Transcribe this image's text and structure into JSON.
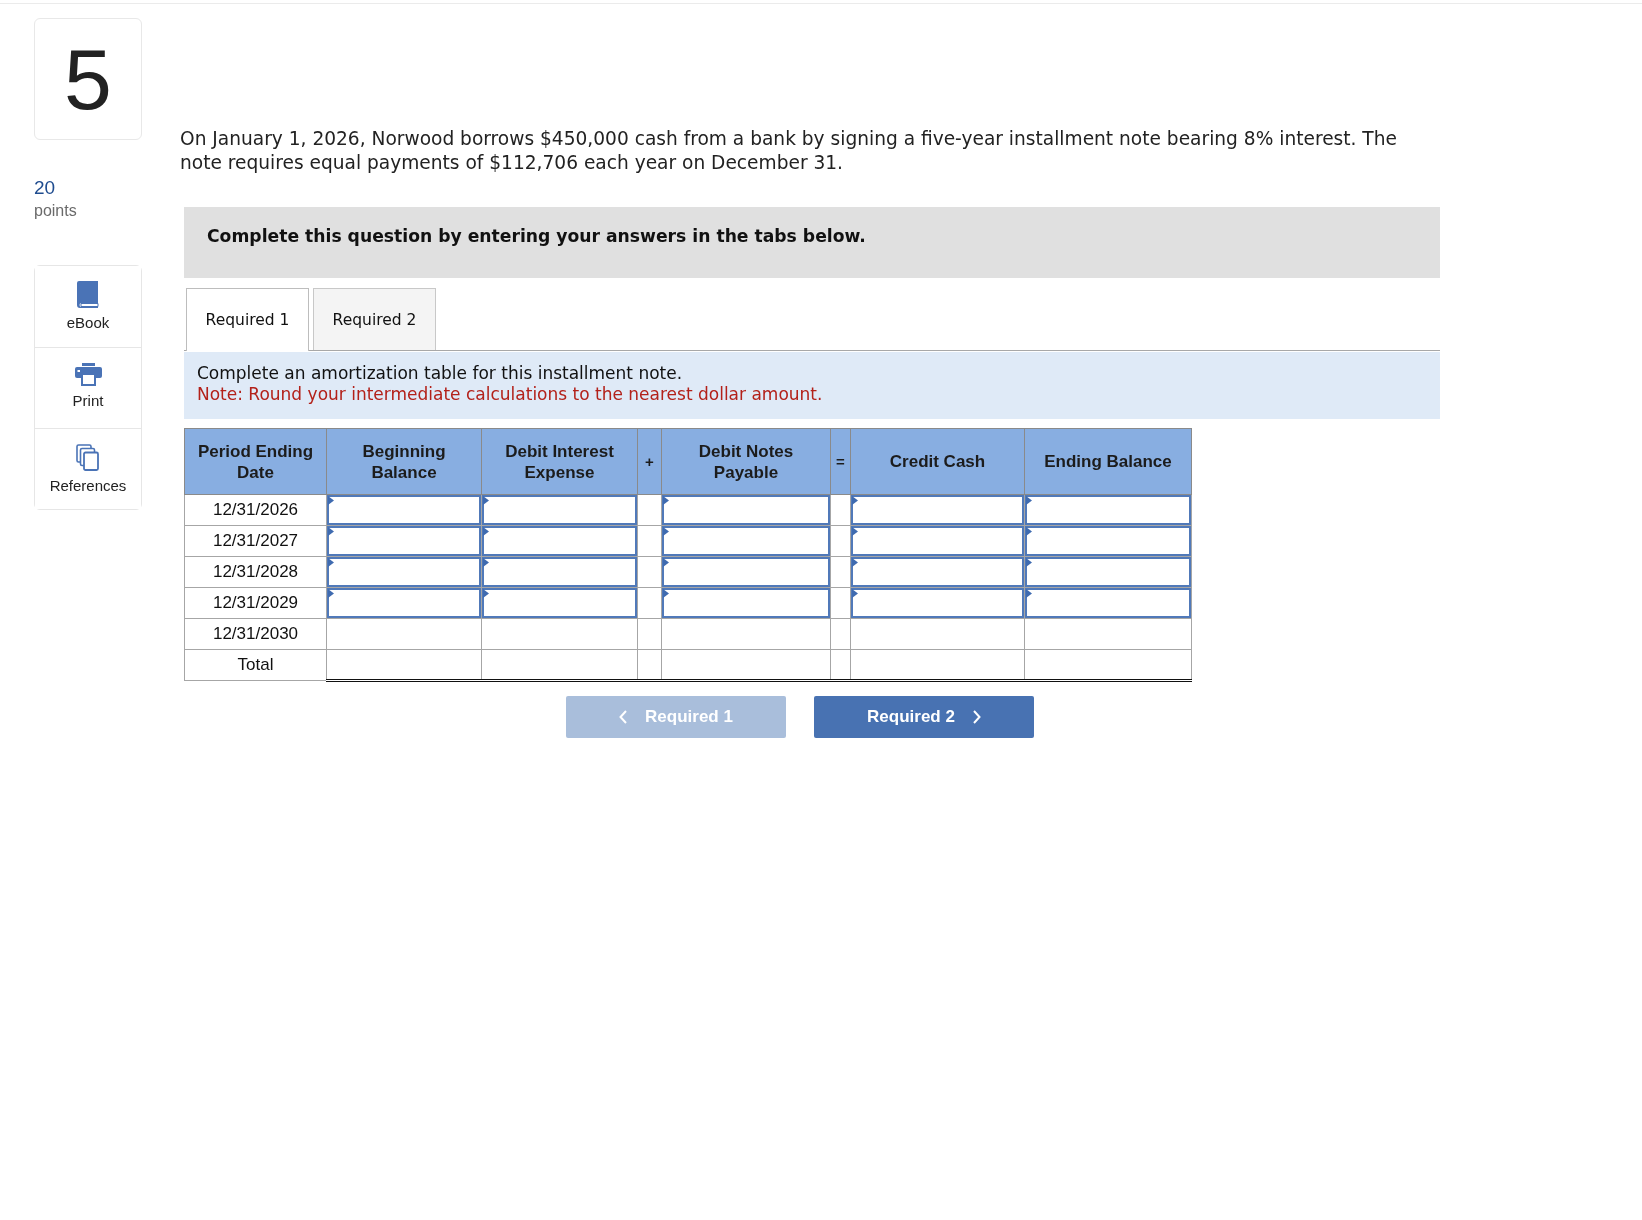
{
  "question": {
    "number": "5",
    "points": "20",
    "points_label": "points"
  },
  "tools": [
    {
      "label": "eBook",
      "kind": "book"
    },
    {
      "label": "Print",
      "kind": "printer"
    },
    {
      "label": "References",
      "kind": "copies"
    }
  ],
  "prompt": "On January 1, 2026, Norwood borrows $450,000 cash from a bank by signing a five-year installment note bearing 8% interest. The note requires equal payments of $112,706 each year on December 31.",
  "instruction_banner": "Complete this question by entering your answers in the tabs below.",
  "tabs": [
    {
      "label": "Required 1",
      "selected": true
    },
    {
      "label": "Required 2",
      "selected": false
    }
  ],
  "task": {
    "text": "Complete an amortization table for this installment note.",
    "note": "Note: Round your intermediate calculations to the nearest dollar amount."
  },
  "table": {
    "columns": [
      {
        "label": "Period Ending Date",
        "kind": "label"
      },
      {
        "label": "Beginning Balance",
        "kind": "value"
      },
      {
        "label": "Debit Interest Expense",
        "kind": "value"
      },
      {
        "label": "+",
        "kind": "operator"
      },
      {
        "label": "Debit Notes Payable",
        "kind": "value"
      },
      {
        "label": "=",
        "kind": "operator"
      },
      {
        "label": "Credit Cash",
        "kind": "value"
      },
      {
        "label": "Ending Balance",
        "kind": "value"
      }
    ],
    "rows": [
      {
        "date": "12/31/2026",
        "kind": "input"
      },
      {
        "date": "12/31/2027",
        "kind": "input"
      },
      {
        "date": "12/31/2028",
        "kind": "input"
      },
      {
        "date": "12/31/2029",
        "kind": "input"
      },
      {
        "date": "12/31/2030",
        "kind": "blank"
      },
      {
        "date": "Total",
        "kind": "total"
      }
    ]
  },
  "nav": [
    {
      "label": "Required 1",
      "kind": "prev",
      "disabled": true
    },
    {
      "label": "Required 2",
      "kind": "next",
      "disabled": false
    }
  ]
}
